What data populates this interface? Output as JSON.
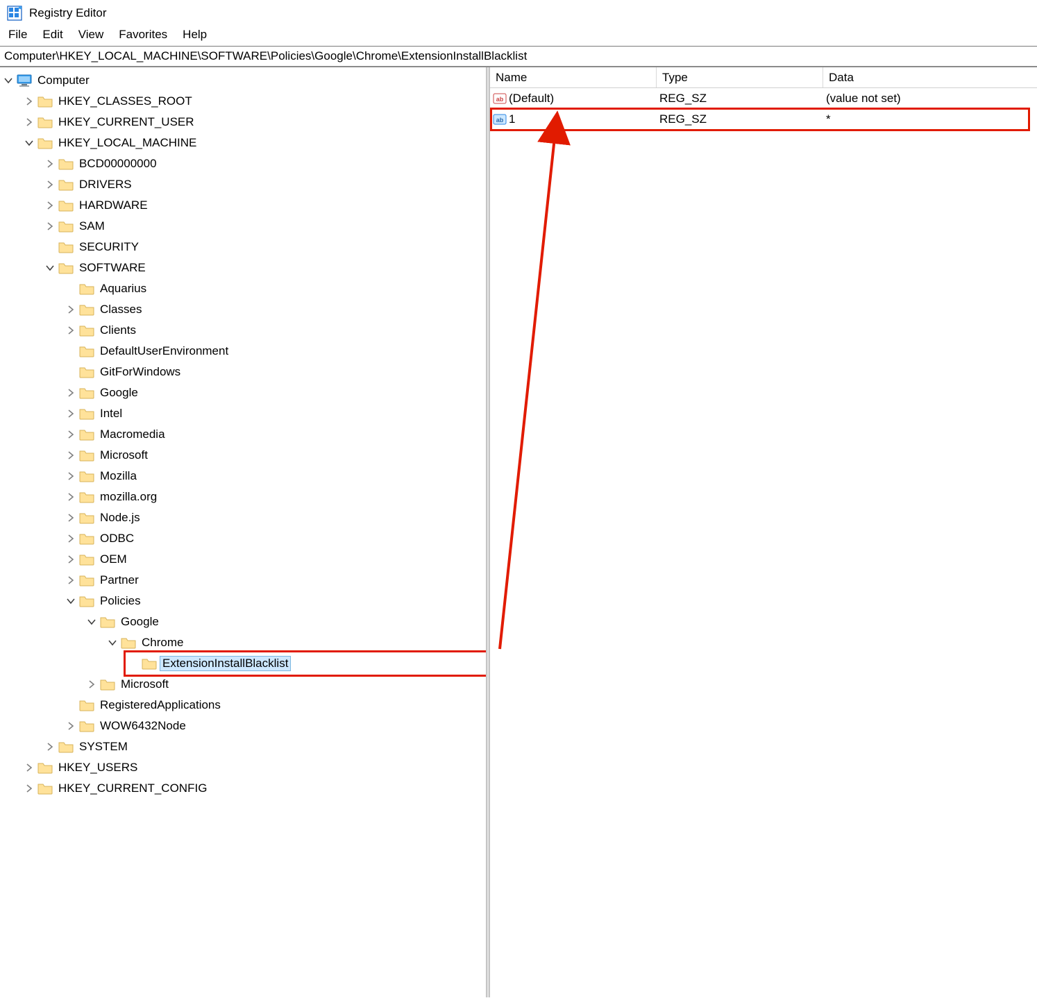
{
  "app": {
    "title": "Registry Editor"
  },
  "menu": {
    "file": "File",
    "edit": "Edit",
    "view": "View",
    "favorites": "Favorites",
    "help": "Help"
  },
  "path": "Computer\\HKEY_LOCAL_MACHINE\\SOFTWARE\\Policies\\Google\\Chrome\\ExtensionInstallBlacklist",
  "list": {
    "headers": {
      "name": "Name",
      "type": "Type",
      "data": "Data"
    },
    "rows": [
      {
        "name": "(Default)",
        "type": "REG_SZ",
        "data": "(value not set)",
        "selected": false
      },
      {
        "name": "1",
        "type": "REG_SZ",
        "data": "*",
        "selected": true
      }
    ]
  },
  "tree": {
    "root": "Computer",
    "hives": {
      "classes_root": "HKEY_CLASSES_ROOT",
      "current_user": "HKEY_CURRENT_USER",
      "local_machine": "HKEY_LOCAL_MACHINE",
      "users": "HKEY_USERS",
      "current_config": "HKEY_CURRENT_CONFIG"
    },
    "hklm_children": {
      "bcd": "BCD00000000",
      "drivers": "DRIVERS",
      "hardware": "HARDWARE",
      "sam": "SAM",
      "security": "SECURITY",
      "software": "SOFTWARE",
      "system": "SYSTEM"
    },
    "software_children": {
      "aquarius": "Aquarius",
      "classes": "Classes",
      "clients": "Clients",
      "defaultuserenv": "DefaultUserEnvironment",
      "gitforwindows": "GitForWindows",
      "google": "Google",
      "intel": "Intel",
      "macromedia": "Macromedia",
      "microsoft": "Microsoft",
      "mozilla": "Mozilla",
      "mozillaorg": "mozilla.org",
      "nodejs": "Node.js",
      "odbc": "ODBC",
      "oem": "OEM",
      "partner": "Partner",
      "policies": "Policies",
      "registeredapps": "RegisteredApplications",
      "wow6432": "WOW6432Node"
    },
    "policies_children": {
      "google": "Google",
      "microsoft": "Microsoft"
    },
    "policies_google_children": {
      "chrome": "Chrome"
    },
    "chrome_children": {
      "ext_blacklist": "ExtensionInstallBlacklist"
    }
  }
}
